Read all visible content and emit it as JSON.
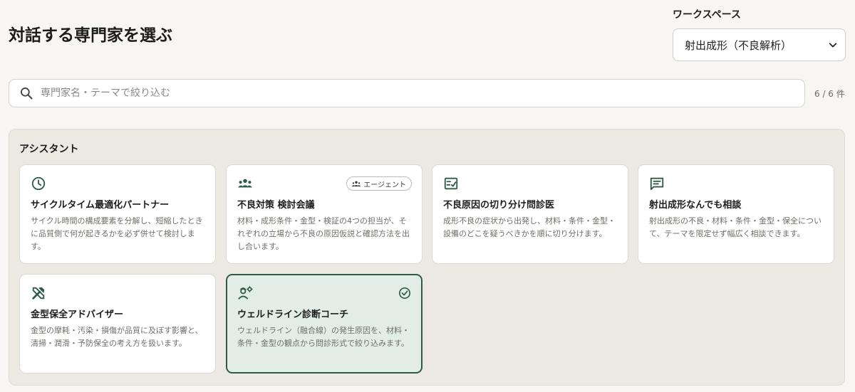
{
  "header": {
    "title": "対話する専門家を選ぶ"
  },
  "workspace": {
    "label": "ワークスペース",
    "selected": "射出成形（不良解析）"
  },
  "search": {
    "placeholder": "専門家名・テーマで絞り込む",
    "value": ""
  },
  "result_count": "6 / 6 件",
  "section": {
    "title": "アシスタント"
  },
  "cards": [
    {
      "icon": "clock-icon",
      "title": "サイクルタイム最適化パートナー",
      "desc": "サイクル時間の構成要素を分解し、短縮したときに品質側で何が起きるかを必ず併せて検討します。"
    },
    {
      "icon": "group-icon",
      "badge": "エージェント",
      "title": "不良対策 検討会議",
      "desc": "材料・成形条件・金型・検証の4つの担当が、それぞれの立場から不良の原因仮説と確認方法を出し合います。"
    },
    {
      "icon": "checklist-icon",
      "title": "不良原因の切り分け問診医",
      "desc": "成形不良の症状から出発し、材料・条件・金型・設備のどこを疑うべきかを順に切り分けます。"
    },
    {
      "icon": "chat-icon",
      "title": "射出成形なんでも相談",
      "desc": "射出成形の不良・材料・条件・金型・保全について、テーマを限定せず幅広く相談できます。"
    },
    {
      "icon": "tools-icon",
      "title": "金型保全アドバイザー",
      "desc": "金型の摩耗・汚染・損傷が品質に及ぼす影響と、清掃・潤滑・予防保全の考え方を扱います。"
    },
    {
      "icon": "engineer-icon",
      "title": "ウェルドライン診断コーチ",
      "desc": "ウェルドライン（融合線）の発生原因を、材料・条件・金型の観点から問診形式で絞り込みます。",
      "selected": true
    }
  ],
  "colors": {
    "accent": "#2f5b46",
    "selected_bg": "#e3ede8",
    "panel_bg": "#ebe9e2"
  }
}
